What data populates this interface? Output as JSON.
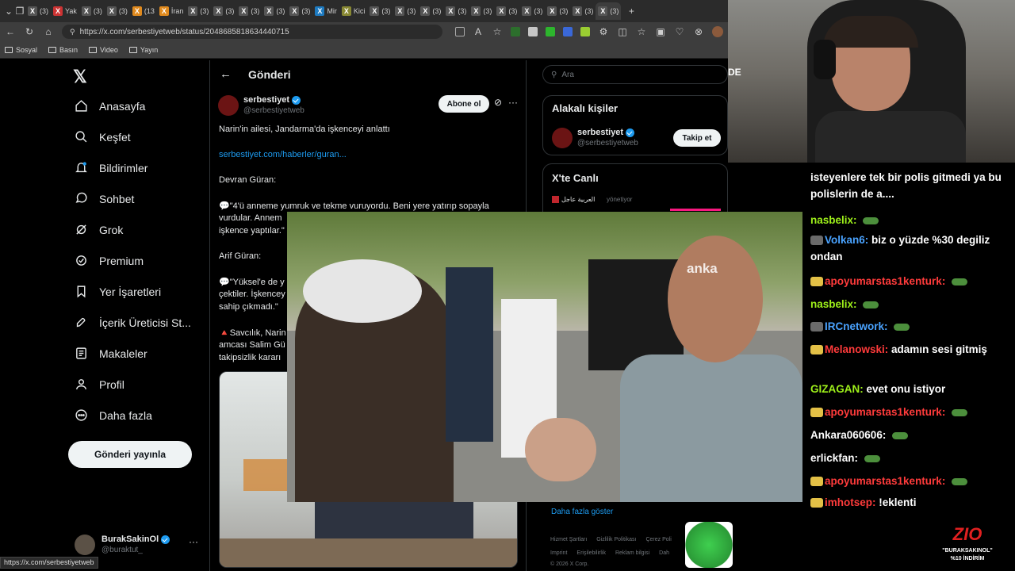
{
  "browser": {
    "tabs": [
      "(3)",
      "Yak",
      "(3)",
      "(3)",
      "(13",
      "İran",
      "(3)",
      "(3)",
      "(3)",
      "(3)",
      "(3)",
      "Mir",
      "Kici",
      "(3)",
      "(3)",
      "(3)",
      "(3)",
      "(3)",
      "(3)",
      "(3)",
      "(3)",
      "(3)",
      "(3)"
    ],
    "url": "https://x.com/serbestiyetweb/status/2048685818634440715",
    "bookmarks": [
      "Sosyal",
      "Basın",
      "Video",
      "Yayın"
    ],
    "status_url": "https://x.com/serbestiyetweb"
  },
  "nav": {
    "items": [
      "Anasayfa",
      "Keşfet",
      "Bildirimler",
      "Sohbet",
      "Grok",
      "Premium",
      "Yer İşaretleri",
      "İçerik Üreticisi St...",
      "Makaleler",
      "Profil",
      "Daha fazla"
    ],
    "post_button": "Gönderi yayınla",
    "account_name": "BurakSakinOl",
    "account_handle": "@buraktut_"
  },
  "main": {
    "header": "Gönderi",
    "author_name": "serbestiyet",
    "author_handle": "@serbestiyetweb",
    "subscribe": "Abone ol",
    "lines": [
      "Narin'in ailesi, Jandarma'da işkenceyi anlattı",
      "serbestiyet.com/haberler/guran...",
      "Devran Güran:",
      "💬\"4'ü anneme yumruk ve tekme vuruyordu. Beni yere yatırıp sopayla",
      "vurdular. Annem",
      "işkence yaptılar.\"",
      "Arif Güran:",
      "💬\"Yüksel'e de y",
      "çektiler. İşkencey",
      "sahip çıkmadı.\"",
      "🔺Savcılık, Narin",
      "amcası Salim Gü",
      "takipsizlik kararı"
    ]
  },
  "right": {
    "search_placeholder": "Ara",
    "related_title": "Alakalı kişiler",
    "related_name": "serbestiyet",
    "related_handle": "@serbestiyetweb",
    "follow": "Takip et",
    "live_title": "X'te Canlı",
    "live_host": "العربية عاجل",
    "live_role": "yönetiyor",
    "show_more": "Daha fazla göster",
    "footer_1": [
      "Hizmet Şartları",
      "Gizlilik Politikası",
      "Çerez Poli"
    ],
    "footer_2": [
      "Imprint",
      "Erişilebilirlik",
      "Reklam bilgisi",
      "Dah"
    ],
    "copyright": "© 2026 X Corp."
  },
  "video": {
    "watermark": "anka"
  },
  "webcam": {
    "lang_badge": "DE"
  },
  "chat": {
    "messages": [
      {
        "user": "",
        "text": "isteyenlere tek bir polis gitmedi ya bu polislerin de a....",
        "color": "#ffffff"
      },
      {
        "user": "nasbelix:",
        "text": "",
        "color": "#9ef01a"
      },
      {
        "user": "Volkan6:",
        "text": "biz o yüzde %30 degiliz ondan",
        "color": "#4aa3ff"
      },
      {
        "user": "apoyumarstas1kenturk:",
        "text": "",
        "color": "#ff3b3b"
      },
      {
        "user": "nasbelix:",
        "text": "",
        "color": "#9ef01a"
      },
      {
        "user": "IRCnetwork:",
        "text": "",
        "color": "#4aa3ff"
      },
      {
        "user": "Melanowski:",
        "text": "adamın sesi gitmiş",
        "color": "#ff3b3b"
      },
      {
        "user": "GIZAGAN:",
        "text": "evet onu istiyor",
        "color": "#9ef01a"
      },
      {
        "user": "apoyumarstas1kenturk:",
        "text": "",
        "color": "#ff3b3b"
      },
      {
        "user": "Ankara060606:",
        "text": "",
        "color": "#ffffff"
      },
      {
        "user": "erlickfan:",
        "text": "",
        "color": "#ffffff"
      },
      {
        "user": "apoyumarstas1kenturk:",
        "text": "",
        "color": "#ff3b3b"
      },
      {
        "user": "imhotsep:",
        "text": "!eklenti",
        "color": "#ff3b3b"
      }
    ]
  },
  "sponsor": {
    "brand": "ZIO",
    "code": "\"BURAKSAKINOL\"",
    "discount": "%10 İNDİRİM"
  }
}
